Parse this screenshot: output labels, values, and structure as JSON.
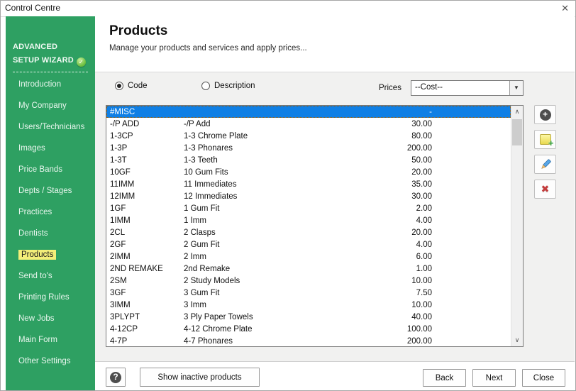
{
  "window": {
    "title": "Control Centre"
  },
  "icons": {
    "close": "✕",
    "check": "✓",
    "plus": "+",
    "note_plus": "+",
    "delete": "✖",
    "question": "?",
    "dropdown_arrow": "▼",
    "scroll_up": "∧",
    "scroll_down": "∨"
  },
  "colors": {
    "sidebar_green": "#2ea062",
    "active_item_yellow": "#f3ee79",
    "selection_blue": "#0f7fe5",
    "badge_green": "#69bd3c",
    "panel_gray": "#f1f1f0"
  },
  "sidebar": {
    "header_line1": "ADVANCED",
    "header_line2": "SETUP WIZARD",
    "items": [
      {
        "name": "sidebar-item-introduction",
        "label": "Introduction",
        "active": false
      },
      {
        "name": "sidebar-item-my-company",
        "label": "My Company",
        "active": false
      },
      {
        "name": "sidebar-item-users-technicians",
        "label": "Users/Technicians",
        "active": false
      },
      {
        "name": "sidebar-item-images",
        "label": "Images",
        "active": false
      },
      {
        "name": "sidebar-item-price-bands",
        "label": "Price Bands",
        "active": false
      },
      {
        "name": "sidebar-item-depts-stages",
        "label": "Depts / Stages",
        "active": false
      },
      {
        "name": "sidebar-item-practices",
        "label": "Practices",
        "active": false
      },
      {
        "name": "sidebar-item-dentists",
        "label": "Dentists",
        "active": false
      },
      {
        "name": "sidebar-item-products",
        "label": "Products",
        "active": true
      },
      {
        "name": "sidebar-item-send-tos",
        "label": "Send to's",
        "active": false
      },
      {
        "name": "sidebar-item-printing-rules",
        "label": "Printing Rules",
        "active": false
      },
      {
        "name": "sidebar-item-new-jobs",
        "label": "New Jobs",
        "active": false
      },
      {
        "name": "sidebar-item-main-form",
        "label": "Main Form",
        "active": false
      },
      {
        "name": "sidebar-item-other-settings",
        "label": "Other Settings",
        "active": false
      }
    ]
  },
  "header": {
    "title": "Products",
    "subtitle": "Manage your products and services and apply prices..."
  },
  "filters": {
    "code_label": "Code",
    "description_label": "Description",
    "prices_label": "Prices",
    "prices_value": "--Cost--"
  },
  "products": {
    "rows": [
      {
        "code": "#MISC",
        "description": "",
        "price": "-",
        "selected": true
      },
      {
        "code": "-/P ADD",
        "description": "-/P Add",
        "price": "30.00",
        "selected": false
      },
      {
        "code": "1-3CP",
        "description": "1-3 Chrome Plate",
        "price": "80.00",
        "selected": false
      },
      {
        "code": "1-3P",
        "description": "1-3 Phonares",
        "price": "200.00",
        "selected": false
      },
      {
        "code": "1-3T",
        "description": "1-3 Teeth",
        "price": "50.00",
        "selected": false
      },
      {
        "code": "10GF",
        "description": "10 Gum Fits",
        "price": "20.00",
        "selected": false
      },
      {
        "code": "11IMM",
        "description": "11 Immediates",
        "price": "35.00",
        "selected": false
      },
      {
        "code": "12IMM",
        "description": "12 Immediates",
        "price": "30.00",
        "selected": false
      },
      {
        "code": "1GF",
        "description": "1 Gum Fit",
        "price": "2.00",
        "selected": false
      },
      {
        "code": "1IMM",
        "description": "1 Imm",
        "price": "4.00",
        "selected": false
      },
      {
        "code": "2CL",
        "description": "2 Clasps",
        "price": "20.00",
        "selected": false
      },
      {
        "code": "2GF",
        "description": "2 Gum Fit",
        "price": "4.00",
        "selected": false
      },
      {
        "code": "2IMM",
        "description": "2 Imm",
        "price": "6.00",
        "selected": false
      },
      {
        "code": "2ND REMAKE",
        "description": "2nd Remake",
        "price": "1.00",
        "selected": false
      },
      {
        "code": "2SM",
        "description": "2 Study Models",
        "price": "10.00",
        "selected": false
      },
      {
        "code": "3GF",
        "description": "3 Gum Fit",
        "price": "7.50",
        "selected": false
      },
      {
        "code": "3IMM",
        "description": "3 Imm",
        "price": "10.00",
        "selected": false
      },
      {
        "code": "3PLYPT",
        "description": "3 Ply Paper Towels",
        "price": "40.00",
        "selected": false
      },
      {
        "code": "4-12CP",
        "description": "4-12 Chrome Plate",
        "price": "100.00",
        "selected": false
      },
      {
        "code": "4-7P",
        "description": "4-7 Phonares",
        "price": "200.00",
        "selected": false
      }
    ]
  },
  "footer": {
    "show_inactive_label": "Show inactive products",
    "back_label": "Back",
    "next_label": "Next",
    "close_label": "Close"
  }
}
